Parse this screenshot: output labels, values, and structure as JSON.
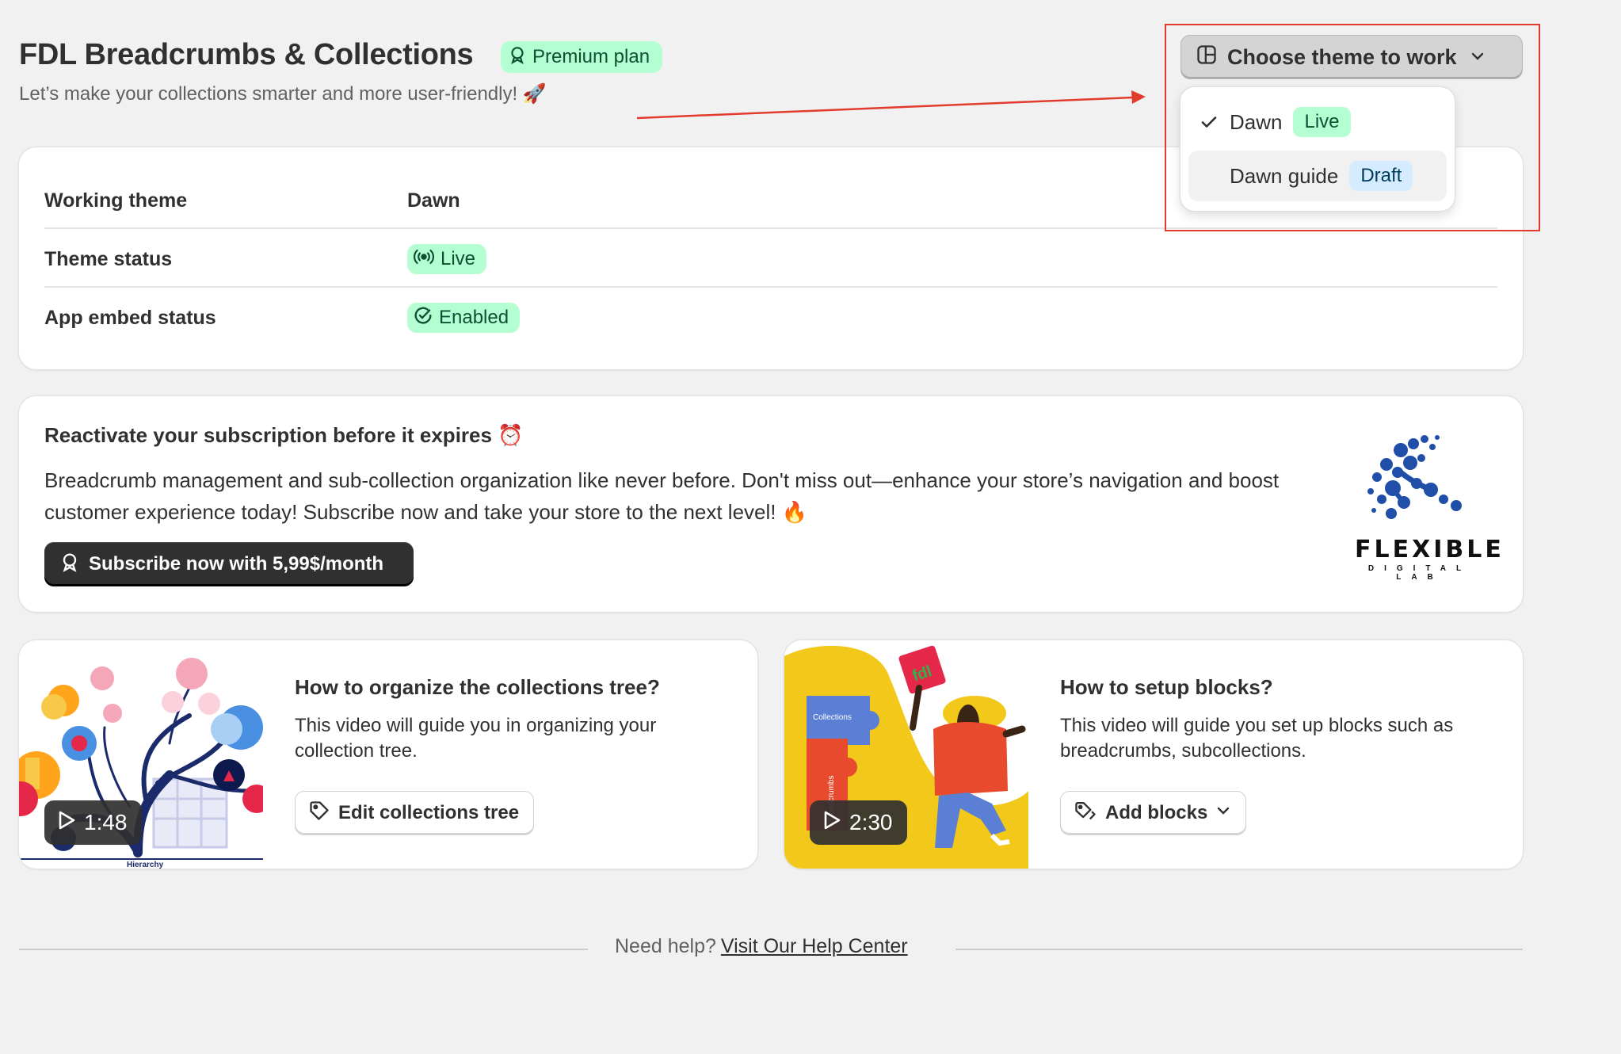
{
  "header": {
    "title": "FDL Breadcrumbs & Collections",
    "plan_badge": "Premium plan",
    "subtitle": "Let’s make your collections smarter and more user-friendly! 🚀"
  },
  "theme_selector": {
    "button_label": "Choose theme to work",
    "options": [
      {
        "name": "Dawn",
        "badge": "Live",
        "selected": true,
        "badge_bg": "#b4fed2",
        "badge_color": "#0c5132"
      },
      {
        "name": "Dawn guide",
        "badge": "Draft",
        "selected": false,
        "badge_bg": "#d5ebff",
        "badge_color": "#003a5a"
      }
    ]
  },
  "theme_info": {
    "rows": [
      {
        "label": "Working theme",
        "value": "Dawn"
      },
      {
        "label": "Theme status",
        "value": "Live"
      },
      {
        "label": "App embed status",
        "value": "Enabled"
      }
    ]
  },
  "subscription": {
    "title": "Reactivate your subscription before it expires ⏰",
    "text": "Breadcrumb management and sub-collection organization like never before. Don't miss out—enhance your store’s navigation and boost customer experience today! Subscribe now and take your store to the next level! 🔥",
    "button_label": "Subscribe now with 5,99$/month",
    "logo_word": "FLEXIBLE",
    "logo_sub": "DIGITAL LAB"
  },
  "videos": [
    {
      "title": "How to organize the collections tree?",
      "description": "This video will guide you in organizing your collection tree.",
      "duration": "1:48",
      "button_label": "Edit collections tree",
      "thumb_caption": "Hierarchy"
    },
    {
      "title": "How to setup blocks?",
      "description": "This video will guide you set up blocks such as breadcrumbs, subcollections.",
      "duration": "2:30",
      "button_label": "Add blocks",
      "thumb_labels": [
        "Collections",
        "Breadcrumbs",
        "fdl"
      ]
    }
  ],
  "footer": {
    "prefix": "Need help?",
    "link_label": "Visit Our Help Center"
  },
  "colors": {
    "background": "#f1f1f1",
    "success_bg": "#b4fed2",
    "success_text": "#0c5132",
    "primary_button": "#303030",
    "annotation_red": "#e23b2e"
  }
}
